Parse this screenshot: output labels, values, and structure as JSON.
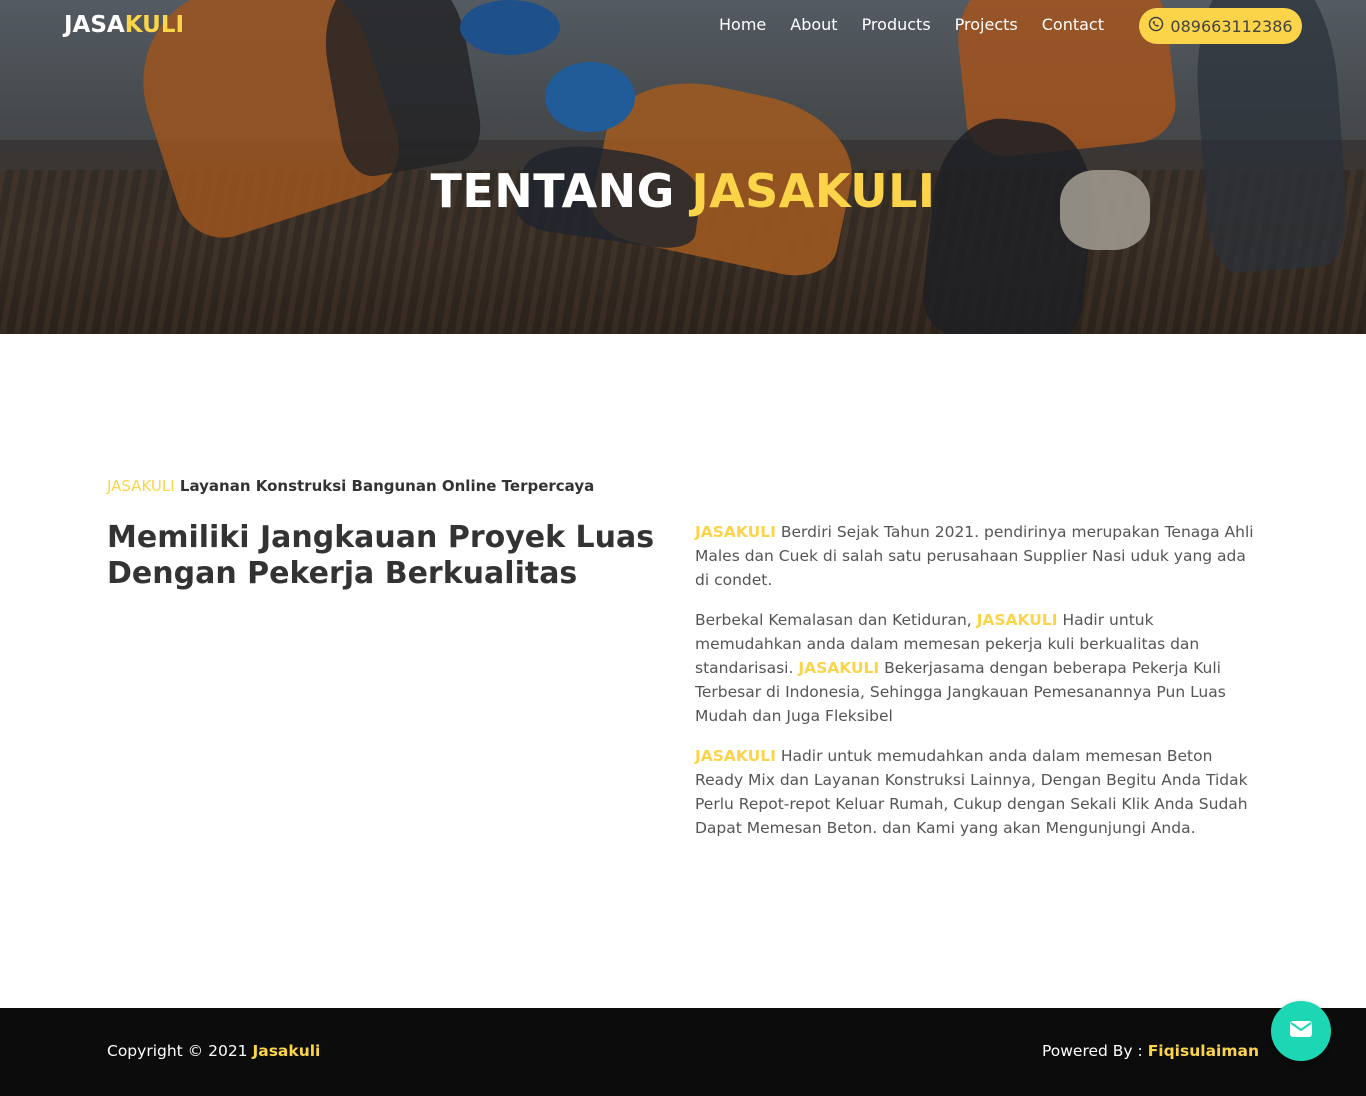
{
  "nav": {
    "brand_part1": "JASA",
    "brand_part2": "KULI",
    "items": [
      {
        "label": "Home"
      },
      {
        "label": "About"
      },
      {
        "label": "Products"
      },
      {
        "label": "Projects"
      },
      {
        "label": "Contact"
      }
    ],
    "phone_icon": "whatsapp-icon",
    "phone": "089663112386"
  },
  "hero": {
    "title_part1": "TENTANG ",
    "title_part2": "JASAKULI"
  },
  "about": {
    "eyebrow_brand": "JASAKULI",
    "eyebrow_text": " Layanan Konstruksi Bangunan Online Terpercaya",
    "heading": "Memiliki Jangkauan Proyek Luas Dengan Pekerja Berkualitas",
    "p1_brand": "JASAKULI",
    "p1_text": " Berdiri Sejak Tahun 2021. pendirinya merupakan Tenaga Ahli Males dan Cuek di salah satu perusahaan Supplier Nasi uduk yang ada di condet.",
    "p2_text_a": "Berbekal Kemalasan dan Ketiduran, ",
    "p2_brand_a": "JASAKULI",
    "p2_text_b": " Hadir untuk memudahkan anda dalam memesan pekerja kuli berkualitas dan standarisasi. ",
    "p2_brand_b": "JASAKULI",
    "p2_text_c": " Bekerjasama dengan beberapa Pekerja Kuli Terbesar di Indonesia, Sehingga Jangkauan Pemesanannya Pun Luas Mudah dan Juga Fleksibel",
    "p3_brand": "JASAKULI",
    "p3_text": " Hadir untuk memudahkan anda dalam memesan Beton Ready Mix dan Layanan Konstruksi Lainnya, Dengan Begitu Anda Tidak Perlu Repot-repot Keluar Rumah, Cukup dengan Sekali Klik Anda Sudah Dapat Memesan Beton. dan Kami yang akan Mengunjungi Anda."
  },
  "footer": {
    "copyright_text": "Copyright © 2021 ",
    "copyright_brand": "Jasakuli",
    "powered_text": "Powered By : ",
    "powered_name": "Fiqisulaiman"
  },
  "float_button": {
    "icon": "envelope-icon"
  },
  "colors": {
    "accent": "#fbd44a",
    "footer_bg": "#0c0c0d",
    "float_btn": "#1dd6b4"
  }
}
